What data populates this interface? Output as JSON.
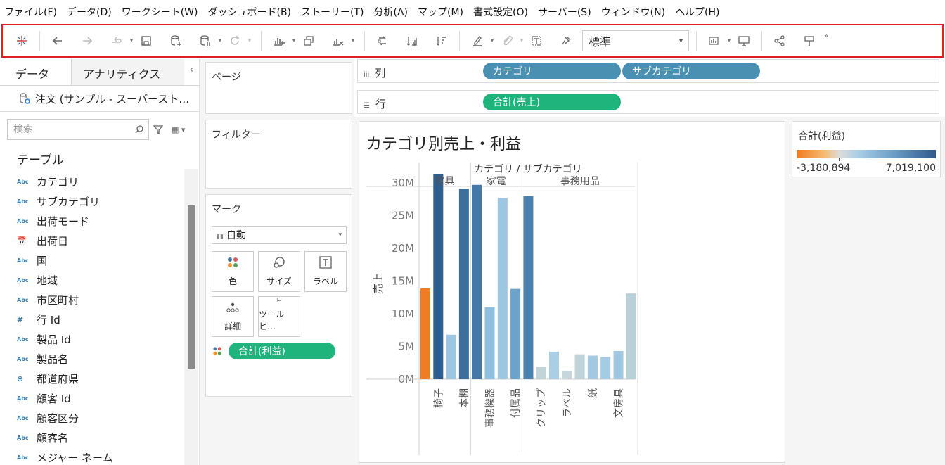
{
  "menu": [
    "ファイル(F)",
    "データ(D)",
    "ワークシート(W)",
    "ダッシュボード(B)",
    "ストーリー(T)",
    "分析(A)",
    "マップ(M)",
    "書式設定(O)",
    "サーバー(S)",
    "ウィンドウ(N)",
    "ヘルプ(H)"
  ],
  "toolbar": {
    "fit_value": "標準",
    "more": "»",
    "icons": [
      "tableau-logo-icon",
      "undo-icon",
      "redo-icon",
      "replay-icon",
      "save-icon",
      "new-datasource-icon",
      "pause-updates-icon",
      "refresh-icon",
      "new-worksheet-icon",
      "duplicate-icon",
      "clear-sheet-icon",
      "swap-icon",
      "sort-ascending-icon",
      "sort-descending-icon",
      "highlight-icon",
      "group-icon",
      "labels-icon",
      "pin-icon",
      "show-me-icon",
      "presentation-icon",
      "share-icon",
      "tooltip-icon"
    ]
  },
  "left": {
    "tab_data": "データ",
    "tab_analytics": "アナリティクス",
    "collapse": "‹",
    "datasource": "注文 (サンプル - スーパースト…",
    "search_placeholder": "検索",
    "tables_header": "テーブル",
    "fields": [
      {
        "type": "Abc",
        "name": "カテゴリ"
      },
      {
        "type": "Abc",
        "name": "サブカテゴリ"
      },
      {
        "type": "Abc",
        "name": "出荷モード"
      },
      {
        "type": "📅",
        "name": "出荷日"
      },
      {
        "type": "Abc",
        "name": "国"
      },
      {
        "type": "Abc",
        "name": "地域"
      },
      {
        "type": "Abc",
        "name": "市区町村"
      },
      {
        "type": "#",
        "name": "行 Id"
      },
      {
        "type": "Abc",
        "name": "製品 Id"
      },
      {
        "type": "Abc",
        "name": "製品名"
      },
      {
        "type": "⊕",
        "name": "都道府県"
      },
      {
        "type": "Abc",
        "name": "顧客 Id"
      },
      {
        "type": "Abc",
        "name": "顧客区分"
      },
      {
        "type": "Abc",
        "name": "顧客名"
      },
      {
        "type": "Abc",
        "name": "メジャー ネーム"
      }
    ]
  },
  "cards": {
    "pages": "ページ",
    "filters": "フィルター",
    "marks": "マーク",
    "mark_type": "自動",
    "buttons": [
      "色",
      "サイズ",
      "ラベル",
      "詳細",
      "ツールヒ…"
    ],
    "mark_pill": "合計(利益)"
  },
  "shelves": {
    "columns_label": "列",
    "columns_icon": "iii",
    "columns_pills": [
      "カテゴリ",
      "サブカテゴリ"
    ],
    "rows_label": "行",
    "rows_icon": "☰",
    "rows_pill": "合計(売上)"
  },
  "viz_title": "カテゴリ別売上・利益",
  "legend": {
    "title": "合計(利益)",
    "min": "-3,180,894",
    "max": "7,019,100"
  },
  "chart_data": {
    "type": "bar",
    "title": "カテゴリ別売上・利益",
    "header": "カテゴリ / サブカテゴリ",
    "ylabel": "売上",
    "ylim": [
      0,
      32
    ],
    "yticks": [
      0,
      5,
      10,
      15,
      20,
      25,
      30
    ],
    "ytick_labels": [
      "0M",
      "5M",
      "10M",
      "15M",
      "20M",
      "25M",
      "30M"
    ],
    "groups": [
      {
        "name": "家具",
        "bars": [
          {
            "label": "",
            "value": 13.9,
            "color": "#f07c26"
          },
          {
            "label": "椅子",
            "value": 31.3,
            "color": "#2d5f8e"
          },
          {
            "label": "",
            "value": 6.8,
            "color": "#9cc7e2"
          },
          {
            "label": "本棚",
            "value": 29.1,
            "color": "#3b6f9e"
          }
        ]
      },
      {
        "name": "家電",
        "bars": [
          {
            "label": "",
            "value": 29.7,
            "color": "#4378a8"
          },
          {
            "label": "事務機器",
            "value": 11.0,
            "color": "#8fc0e0"
          },
          {
            "label": "",
            "value": 27.7,
            "color": "#9cc7e2"
          },
          {
            "label": "付属品",
            "value": 13.8,
            "color": "#6da2c9"
          }
        ]
      },
      {
        "name": "事務用品",
        "bars": [
          {
            "label": "",
            "value": 28.0,
            "color": "#4a80ae"
          },
          {
            "label": "クリップ",
            "value": 1.9,
            "color": "#c2d4d8"
          },
          {
            "label": "",
            "value": 4.2,
            "color": "#a9cee6"
          },
          {
            "label": "ラベル",
            "value": 1.3,
            "color": "#c6d6da"
          },
          {
            "label": "",
            "value": 3.8,
            "color": "#c0d3d8"
          },
          {
            "label": "紙",
            "value": 3.6,
            "color": "#a2c8e2"
          },
          {
            "label": "",
            "value": 3.4,
            "color": "#a6cbe4"
          },
          {
            "label": "文房具",
            "value": 4.3,
            "color": "#a0c7e2"
          },
          {
            "label": "",
            "value": 13.1,
            "color": "#b8d0d8"
          }
        ]
      }
    ]
  }
}
